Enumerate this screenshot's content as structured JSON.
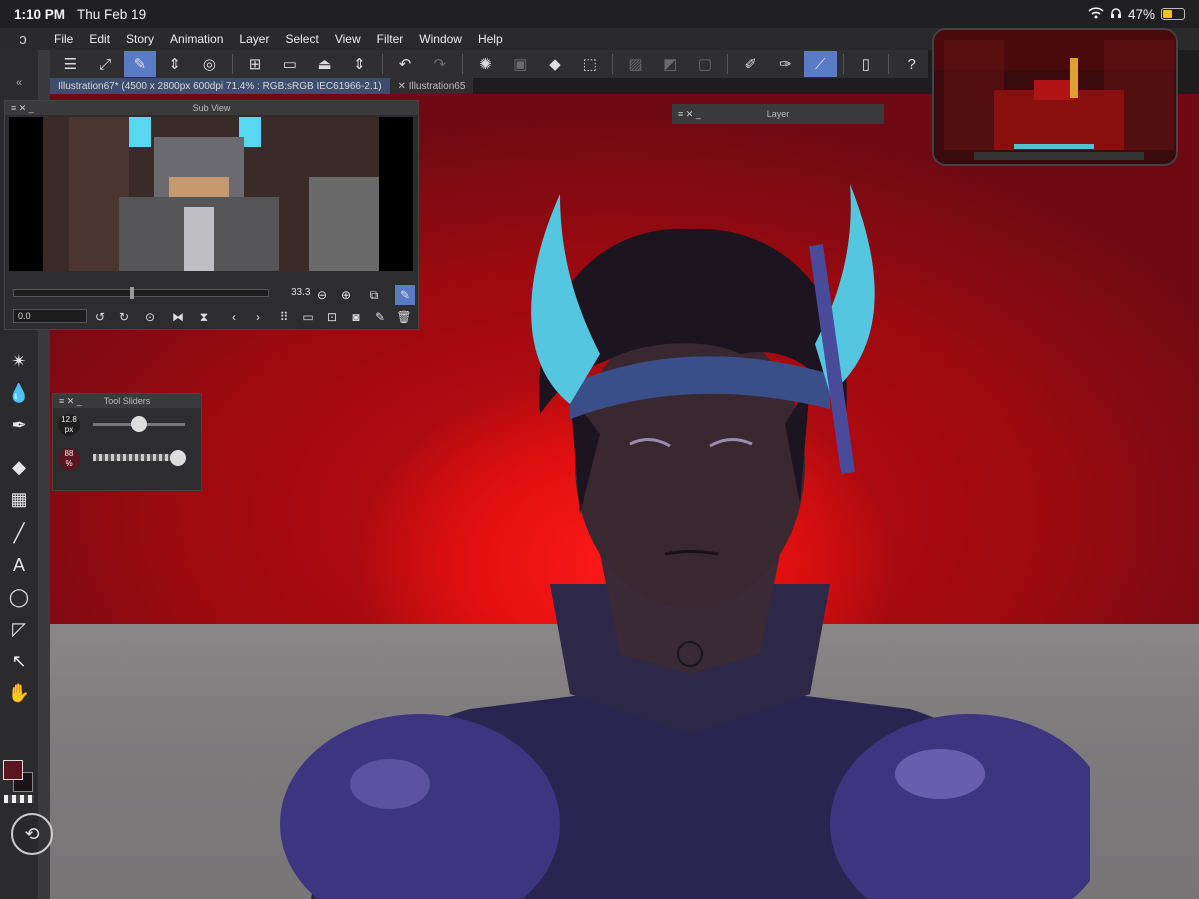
{
  "status": {
    "time": "1:10 PM",
    "date": "Thu Feb 19",
    "battery": "47%",
    "battery_level": 0.47
  },
  "menu": {
    "items": [
      "File",
      "Edit",
      "Story",
      "Animation",
      "Layer",
      "Select",
      "View",
      "Filter",
      "Window",
      "Help"
    ]
  },
  "tabs": {
    "active": "Illustration67* (4500 x 2800px 600dpi 71.4% : RGB:sRGB IEC61966-2.1)",
    "other": "Illustration65"
  },
  "subview": {
    "title": "Sub View",
    "zoom": "33.3",
    "angle": "0.0"
  },
  "layer_panel": {
    "title": "Layer"
  },
  "tool_sliders": {
    "title": "Tool Sliders",
    "size": "12.8",
    "size_unit": "px",
    "opacity": "88",
    "opacity_unit": "%",
    "size_level": 0.5,
    "opacity_level": 0.88
  },
  "colors": {
    "main": "#5a1620",
    "sub": "#1a1417",
    "accent": "#5a7cc7"
  },
  "icons": {
    "command_bar": [
      "menu-icon",
      "fit-icon",
      "edit-icon",
      "updown-icon",
      "spiral-icon",
      "new-file-icon",
      "open-folder-icon",
      "save-icon",
      "updown-icon",
      "undo-icon",
      "redo-icon",
      "loading-icon",
      "deselect-icon",
      "fill-icon",
      "transform-icon",
      "clear-icon",
      "clear-outside-icon",
      "fit-selection-icon",
      "pen-tool-icon",
      "brush-tool-icon",
      "ruler-tool-icon",
      "phone-icon",
      "help-icon"
    ],
    "left_tools": [
      "sparkle-icon",
      "blend-icon",
      "pen-icon",
      "fill-icon",
      "gradient-icon",
      "line-icon",
      "text-icon",
      "lasso-icon",
      "operation-icon",
      "move-icon",
      "hand-icon"
    ]
  }
}
